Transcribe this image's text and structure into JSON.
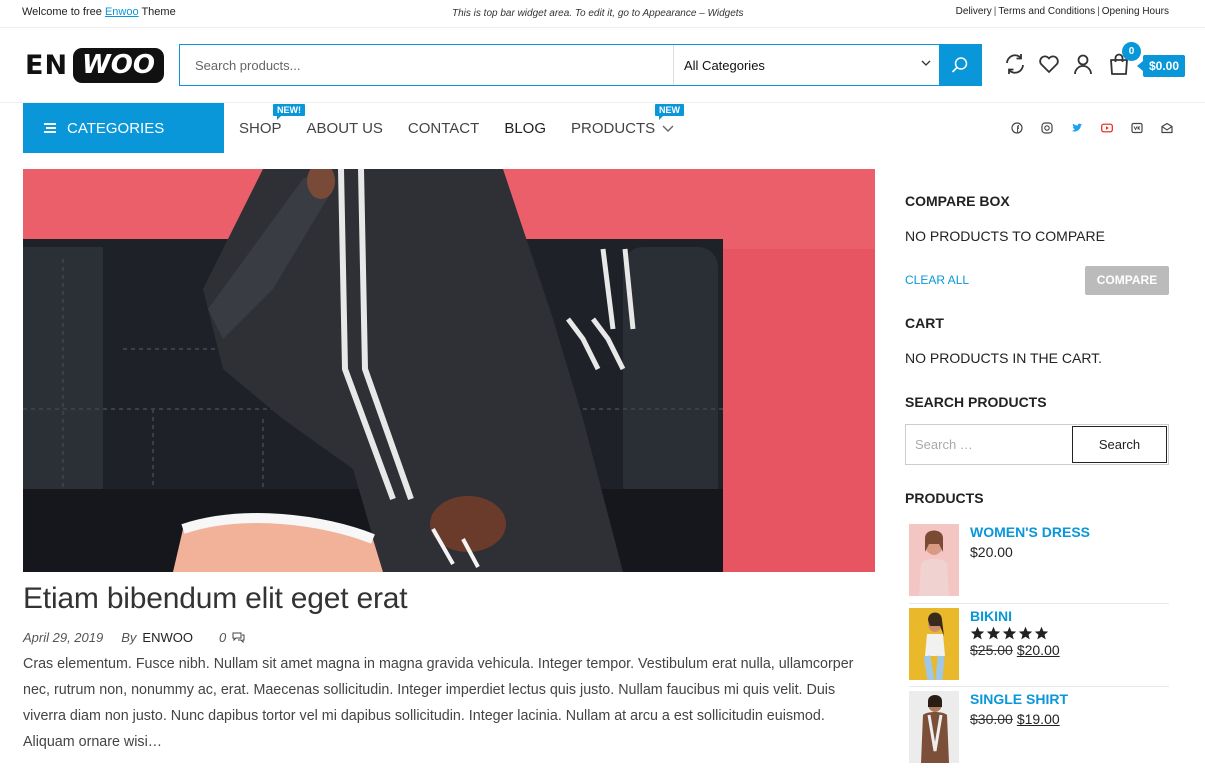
{
  "topbar": {
    "welcome_prefix": "Welcome to free",
    "welcome_link": "Enwoo",
    "welcome_suffix": "Theme",
    "widget_text": "This is top bar widget area. To edit it, go to Appearance – Widgets",
    "links": [
      "Delivery",
      "Terms and Conditions",
      "Opening Hours"
    ]
  },
  "logo": {
    "part1": "EN",
    "part2": "WOO"
  },
  "search": {
    "placeholder": "Search products...",
    "category": "All Categories"
  },
  "header": {
    "cart_count": "0",
    "cart_total": "$0.00"
  },
  "nav": {
    "categories_label": "CATEGORIES",
    "items": [
      {
        "label": "SHOP",
        "tag": "NEW!"
      },
      {
        "label": "ABOUT US"
      },
      {
        "label": "CONTACT"
      },
      {
        "label": "BLOG"
      },
      {
        "label": "PRODUCTS",
        "tag": "NEW"
      }
    ],
    "social": [
      "facebook-icon",
      "instagram-icon",
      "twitter-icon",
      "youtube-icon",
      "vk-icon",
      "email-icon"
    ]
  },
  "colors": {
    "accent": "#0a97d9",
    "hero_bg": "#e75563"
  },
  "post": {
    "title": "Etiam bibendum elit eget erat",
    "date": "April 29, 2019",
    "by": "By",
    "author": "ENWOO",
    "comments": "0",
    "excerpt": "Cras elementum. Fusce nibh. Nullam sit amet magna in magna gravida vehicula. Integer tempor. Vestibulum erat nulla, ullamcorper nec, rutrum non, nonummy ac, erat. Maecenas sollicitudin. Integer imperdiet lectus quis justo. Nullam faucibus mi quis velit. Duis viverra diam non justo. Nunc dapibus tortor vel mi dapibus sollicitudin. Integer lacinia. Nullam at arcu a est sollicitudin euismod. Aliquam ornare wisi…"
  },
  "sidebar": {
    "compare_title": "COMPARE BOX",
    "compare_empty": "NO PRODUCTS TO COMPARE",
    "clear_all": "CLEAR ALL",
    "compare_button": "COMPARE",
    "cart_title": "CART",
    "cart_empty": "NO PRODUCTS IN THE CART.",
    "search_title": "SEARCH PRODUCTS",
    "search_placeholder": "Search …",
    "search_button": "Search",
    "products_title": "PRODUCTS",
    "products": [
      {
        "name": "WOMEN'S DRESS",
        "price": "$20.00"
      },
      {
        "name": "BIKINI",
        "rating": 5,
        "old_price": "$25.00",
        "price": "$20.00"
      },
      {
        "name": "SINGLE SHIRT",
        "old_price": "$30.00",
        "price": "$19.00"
      }
    ]
  }
}
